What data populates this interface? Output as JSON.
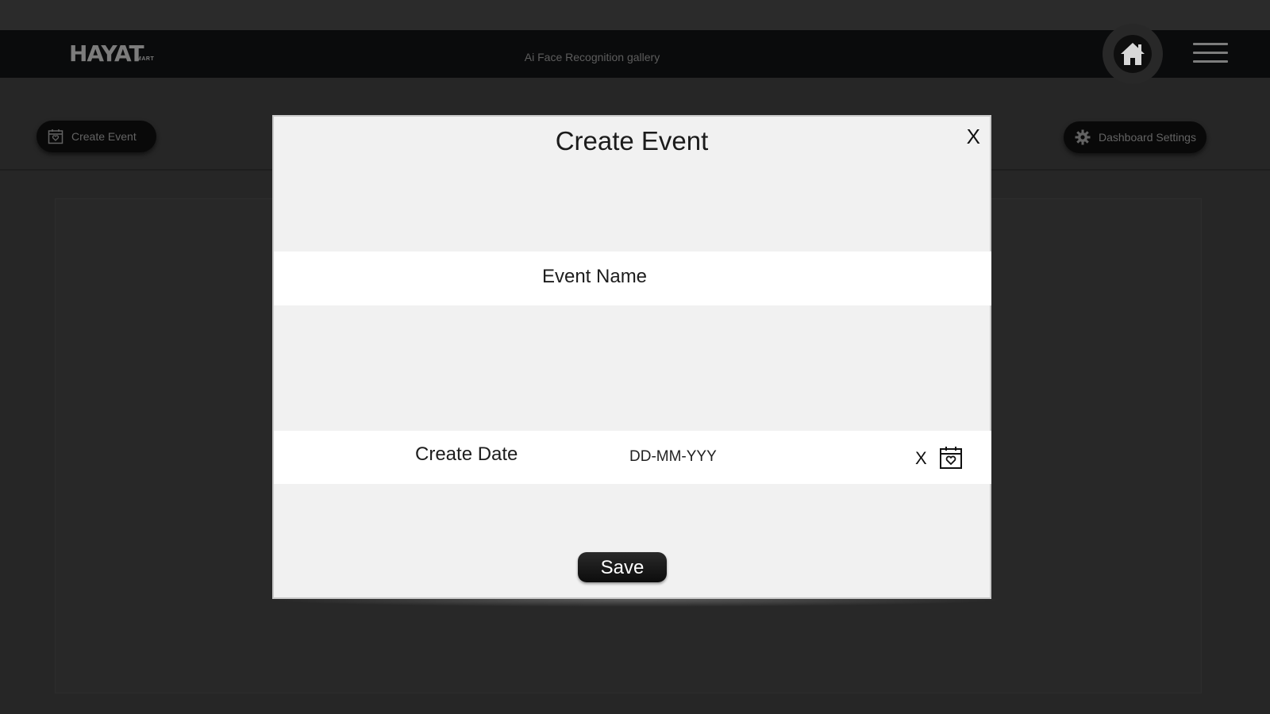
{
  "navbar": {
    "logo_text": "HAYAT",
    "logo_sub": "MART",
    "title": "Ai Face Recognition gallery",
    "home_icon": "home-icon",
    "menu_icon": "hamburger-menu-icon"
  },
  "toolbar": {
    "create_event_label": "Create Event",
    "create_event_icon": "calendar-icon",
    "dashboard_settings_label": "Dashboard Settings",
    "dashboard_settings_icon": "gear-icon"
  },
  "modal": {
    "title": "Create Event",
    "close_label": "X",
    "event_name_label": "Event Name",
    "create_date_label": "Create Date",
    "date_placeholder": "DD-MM-YYY",
    "date_clear_label": "X",
    "calendar_icon": "calendar-heart-icon",
    "save_label": "Save"
  },
  "colors": {
    "background": "#262626",
    "navbar": "#0a0b0c",
    "modal": "#f1f1f1",
    "field_row": "#ffffff",
    "button_dark": "#0c0c0c"
  }
}
